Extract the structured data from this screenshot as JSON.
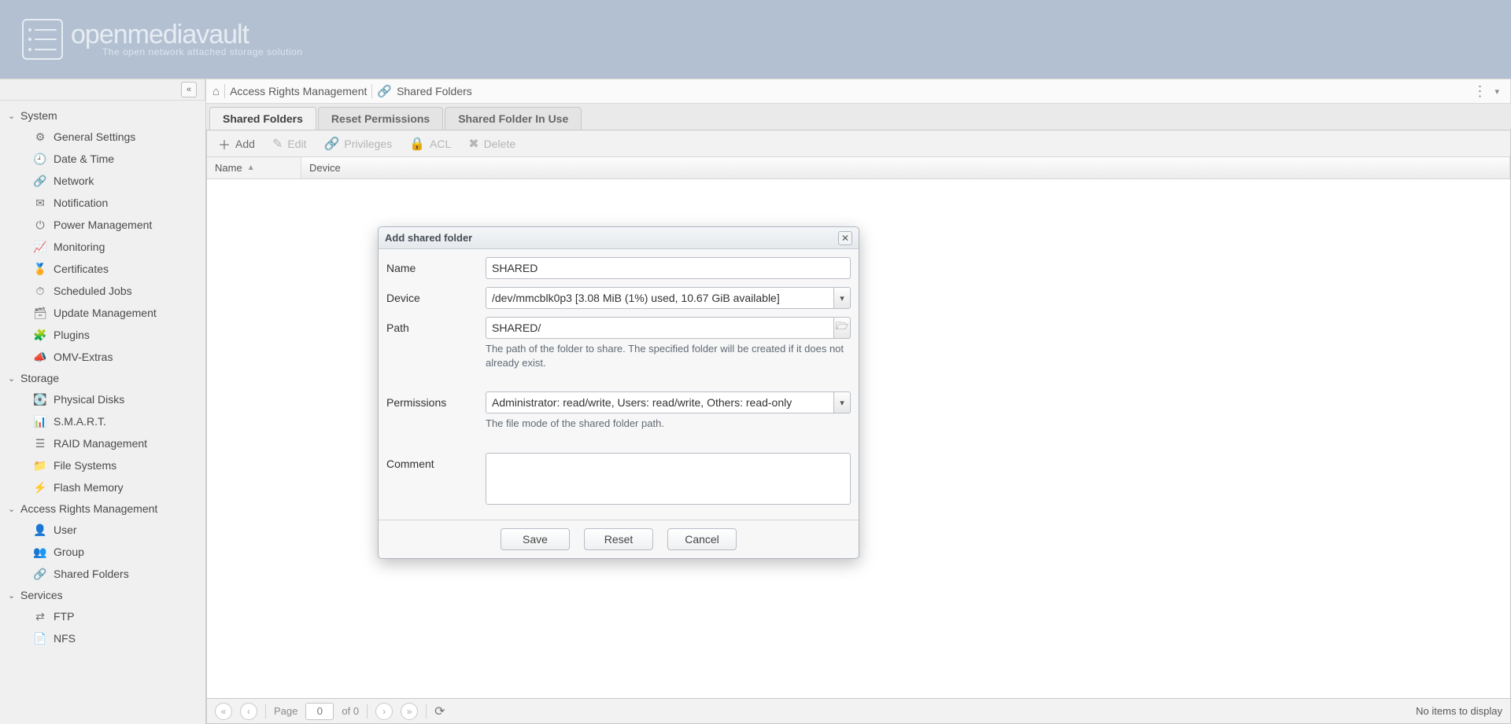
{
  "brand": {
    "title": "openmediavault",
    "subtitle": "The open network attached storage solution"
  },
  "breadcrumb": {
    "home": "⌂",
    "sect": "Access Rights Management",
    "page": "Shared Folders"
  },
  "tabs": {
    "t0": "Shared Folders",
    "t1": "Reset Permissions",
    "t2": "Shared Folder In Use"
  },
  "toolbar": {
    "add": "Add",
    "edit": "Edit",
    "priv": "Privileges",
    "acl": "ACL",
    "del": "Delete"
  },
  "grid": {
    "cols": {
      "name": "Name",
      "device": "Device"
    }
  },
  "status": {
    "pageLabel": "Page",
    "pageNo": "0",
    "ofLabel": "of 0",
    "empty": "No items to display"
  },
  "sidebar": {
    "system": {
      "title": "System",
      "items": [
        {
          "label": "General Settings",
          "icon": "⚙"
        },
        {
          "label": "Date & Time",
          "icon": "🕘"
        },
        {
          "label": "Network",
          "icon": "🔗"
        },
        {
          "label": "Notification",
          "icon": "✉"
        },
        {
          "label": "Power Management",
          "icon": "⏻"
        },
        {
          "label": "Monitoring",
          "icon": "📈"
        },
        {
          "label": "Certificates",
          "icon": "🏅"
        },
        {
          "label": "Scheduled Jobs",
          "icon": "⏱"
        },
        {
          "label": "Update Management",
          "icon": "🗃"
        },
        {
          "label": "Plugins",
          "icon": "🧩"
        },
        {
          "label": "OMV-Extras",
          "icon": "📣"
        }
      ]
    },
    "storage": {
      "title": "Storage",
      "items": [
        {
          "label": "Physical Disks",
          "icon": "💽"
        },
        {
          "label": "S.M.A.R.T.",
          "icon": "📊"
        },
        {
          "label": "RAID Management",
          "icon": "☰"
        },
        {
          "label": "File Systems",
          "icon": "📁"
        },
        {
          "label": "Flash Memory",
          "icon": "⚡"
        }
      ]
    },
    "arm": {
      "title": "Access Rights Management",
      "items": [
        {
          "label": "User",
          "icon": "👤"
        },
        {
          "label": "Group",
          "icon": "👥"
        },
        {
          "label": "Shared Folders",
          "icon": "🔗"
        }
      ]
    },
    "services": {
      "title": "Services",
      "items": [
        {
          "label": "FTP",
          "icon": "⇄"
        },
        {
          "label": "NFS",
          "icon": "📄"
        }
      ]
    }
  },
  "dialog": {
    "title": "Add shared folder",
    "labels": {
      "name": "Name",
      "device": "Device",
      "path": "Path",
      "permissions": "Permissions",
      "comment": "Comment"
    },
    "values": {
      "name": "SHARED",
      "device": "/dev/mmcblk0p3 [3.08 MiB (1%) used, 10.67 GiB available]",
      "path": "SHARED/",
      "permissions": "Administrator: read/write, Users: read/write, Others: read-only",
      "comment": ""
    },
    "help": {
      "path": "The path of the folder to share. The specified folder will be created if it does not already exist.",
      "permissions": "The file mode of the shared folder path."
    },
    "buttons": {
      "save": "Save",
      "reset": "Reset",
      "cancel": "Cancel"
    }
  }
}
